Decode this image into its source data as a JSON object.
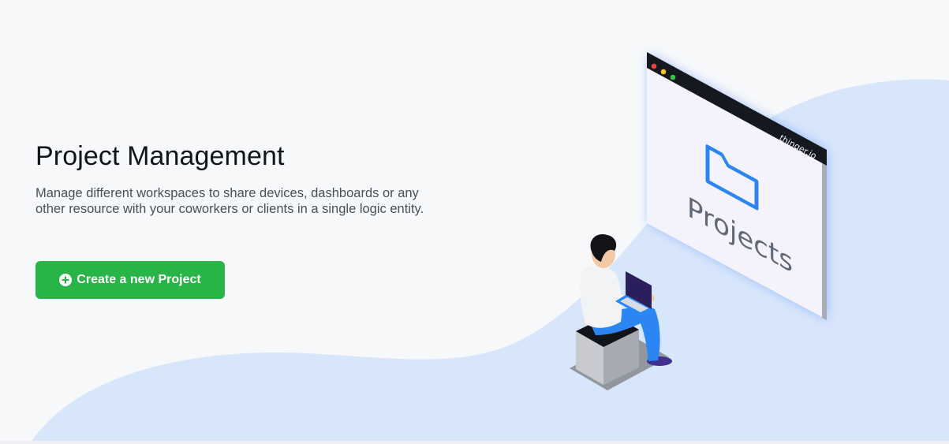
{
  "hero": {
    "title": "Project Management",
    "description": "Manage different workspaces to share devices, dashboards or any other resource with your coworkers or clients in a single logic entity.",
    "create_button_label": "Create a new Project",
    "create_button_icon": "plus-circle-icon",
    "button_color": "#28b446"
  },
  "illustration": {
    "window_brand": "thinger.io",
    "window_label": "Projects",
    "folder_icon": "folder-icon",
    "accent_color": "#2b86f3",
    "wave_color": "#d8e6fb"
  }
}
